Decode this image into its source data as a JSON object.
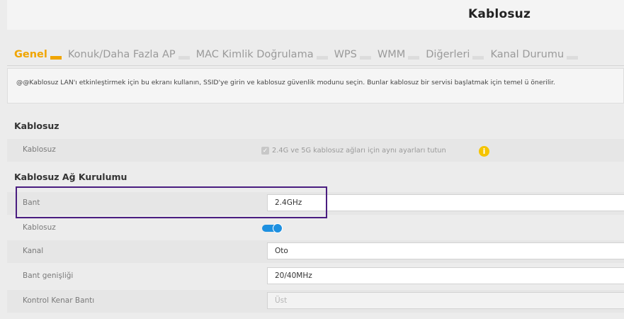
{
  "header": {
    "title": "Kablosuz"
  },
  "tabs": [
    {
      "label": "Genel"
    },
    {
      "label": "Konuk/Daha Fazla AP"
    },
    {
      "label": "MAC Kimlik Doğrulama"
    },
    {
      "label": "WPS"
    },
    {
      "label": "WMM"
    },
    {
      "label": "Diğerleri"
    },
    {
      "label": "Kanal Durumu"
    }
  ],
  "info": {
    "text": "@@Kablosuz LAN'ı etkinleştirmek için bu ekranı kullanın, SSID'ye girin ve kablosuz güvenlik modunu seçin. Bunlar kablosuz bir servisi başlatmak için temel ü önerilir."
  },
  "sections": {
    "wireless": "Kablosuz",
    "network_setup": "Kablosuz Ağ Kurulumu"
  },
  "wireless": {
    "label": "Kablosuz",
    "same_settings_label": "2.4G ve 5G kablosuz ağları için aynı ayarları tutun",
    "same_settings_checked": true
  },
  "setup": {
    "band_label": "Bant",
    "band_value": "2.4GHz",
    "wireless_label": "Kablosuz",
    "wireless_enabled": true,
    "channel_label": "Kanal",
    "channel_value": "Oto",
    "bandwidth_label": "Bant genişliği",
    "bandwidth_value": "20/40MHz",
    "sideband_label": "Kontrol Kenar Bantı",
    "sideband_value": "Üst"
  },
  "colors": {
    "accent": "#f0a500",
    "toggle": "#1e90e0",
    "highlight": "#4a1d80",
    "info_icon": "#f5c400"
  }
}
